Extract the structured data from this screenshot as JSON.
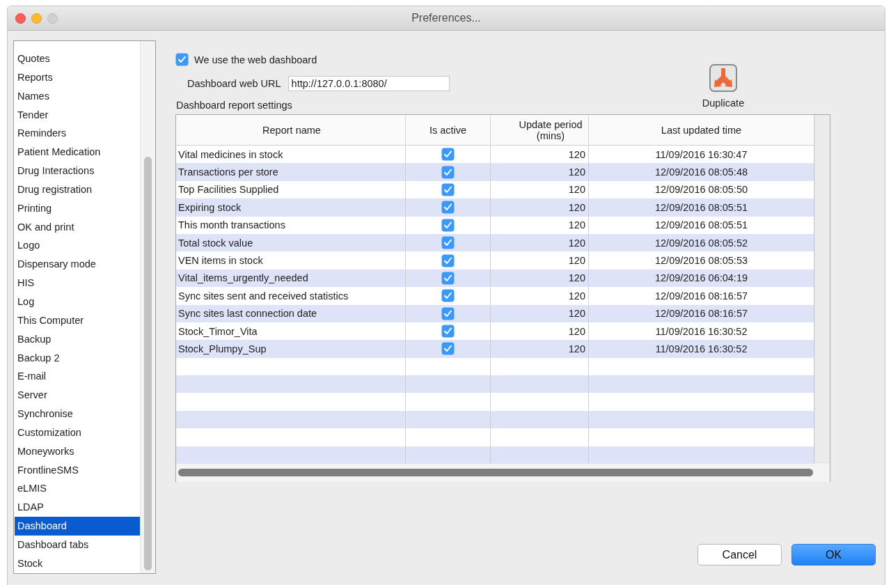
{
  "window": {
    "title": "Preferences..."
  },
  "sidebar": {
    "items": [
      {
        "label": "Quotes",
        "selected": false
      },
      {
        "label": "Reports",
        "selected": false
      },
      {
        "label": "Names",
        "selected": false
      },
      {
        "label": "Tender",
        "selected": false
      },
      {
        "label": "Reminders",
        "selected": false
      },
      {
        "label": "Patient Medication",
        "selected": false
      },
      {
        "label": "Drug Interactions",
        "selected": false
      },
      {
        "label": "Drug registration",
        "selected": false
      },
      {
        "label": "Printing",
        "selected": false
      },
      {
        "label": "OK and print",
        "selected": false
      },
      {
        "label": "Logo",
        "selected": false
      },
      {
        "label": "Dispensary mode",
        "selected": false
      },
      {
        "label": "HIS",
        "selected": false
      },
      {
        "label": "Log",
        "selected": false
      },
      {
        "label": "This Computer",
        "selected": false
      },
      {
        "label": "Backup",
        "selected": false
      },
      {
        "label": "Backup 2",
        "selected": false
      },
      {
        "label": "E-mail",
        "selected": false
      },
      {
        "label": "Server",
        "selected": false
      },
      {
        "label": "Synchronise",
        "selected": false
      },
      {
        "label": "Customization",
        "selected": false
      },
      {
        "label": "Moneyworks",
        "selected": false
      },
      {
        "label": "FrontlineSMS",
        "selected": false
      },
      {
        "label": "eLMIS",
        "selected": false
      },
      {
        "label": "LDAP",
        "selected": false
      },
      {
        "label": "Dashboard",
        "selected": true
      },
      {
        "label": "Dashboard tabs",
        "selected": false
      },
      {
        "label": "Stock",
        "selected": false
      }
    ]
  },
  "web_dashboard": {
    "label": "We use the web dashboard",
    "checked": true
  },
  "url": {
    "label": "Dashboard web URL",
    "value": "http://127.0.0.1:8080/"
  },
  "section_label": "Dashboard report settings",
  "duplicate_button": {
    "label": "Duplicate"
  },
  "table": {
    "columns": [
      "Report name",
      "Is active",
      "Update period (mins)",
      "Last updated time"
    ],
    "rows": [
      {
        "name": "Vital medicines in stock",
        "active": true,
        "period": "120",
        "updated": "11/09/2016 16:30:47"
      },
      {
        "name": "Transactions per store",
        "active": true,
        "period": "120",
        "updated": "12/09/2016 08:05:48"
      },
      {
        "name": "Top Facilities Supplied",
        "active": true,
        "period": "120",
        "updated": "12/09/2016 08:05:50"
      },
      {
        "name": "Expiring stock",
        "active": true,
        "period": "120",
        "updated": "12/09/2016 08:05:51"
      },
      {
        "name": "This month transactions",
        "active": true,
        "period": "120",
        "updated": "12/09/2016 08:05:51"
      },
      {
        "name": "Total stock value",
        "active": true,
        "period": "120",
        "updated": "12/09/2016 08:05:52"
      },
      {
        "name": "VEN items in stock",
        "active": true,
        "period": "120",
        "updated": "12/09/2016 08:05:53"
      },
      {
        "name": "Vital_items_urgently_needed",
        "active": true,
        "period": "120",
        "updated": "12/09/2016 06:04:19"
      },
      {
        "name": "Sync sites sent and received statistics",
        "active": true,
        "period": "120",
        "updated": "12/09/2016 08:16:57"
      },
      {
        "name": "Sync sites last connection date",
        "active": true,
        "period": "120",
        "updated": "12/09/2016 08:16:57"
      },
      {
        "name": "Stock_Timor_Vita",
        "active": true,
        "period": "120",
        "updated": "11/09/2016 16:30:52"
      },
      {
        "name": "Stock_Plumpy_Sup",
        "active": true,
        "period": "120",
        "updated": "11/09/2016 16:30:52"
      }
    ]
  },
  "buttons": [
    {
      "label": "Cancel",
      "kind": "secondary"
    },
    {
      "label": "OK",
      "kind": "default"
    }
  ]
}
